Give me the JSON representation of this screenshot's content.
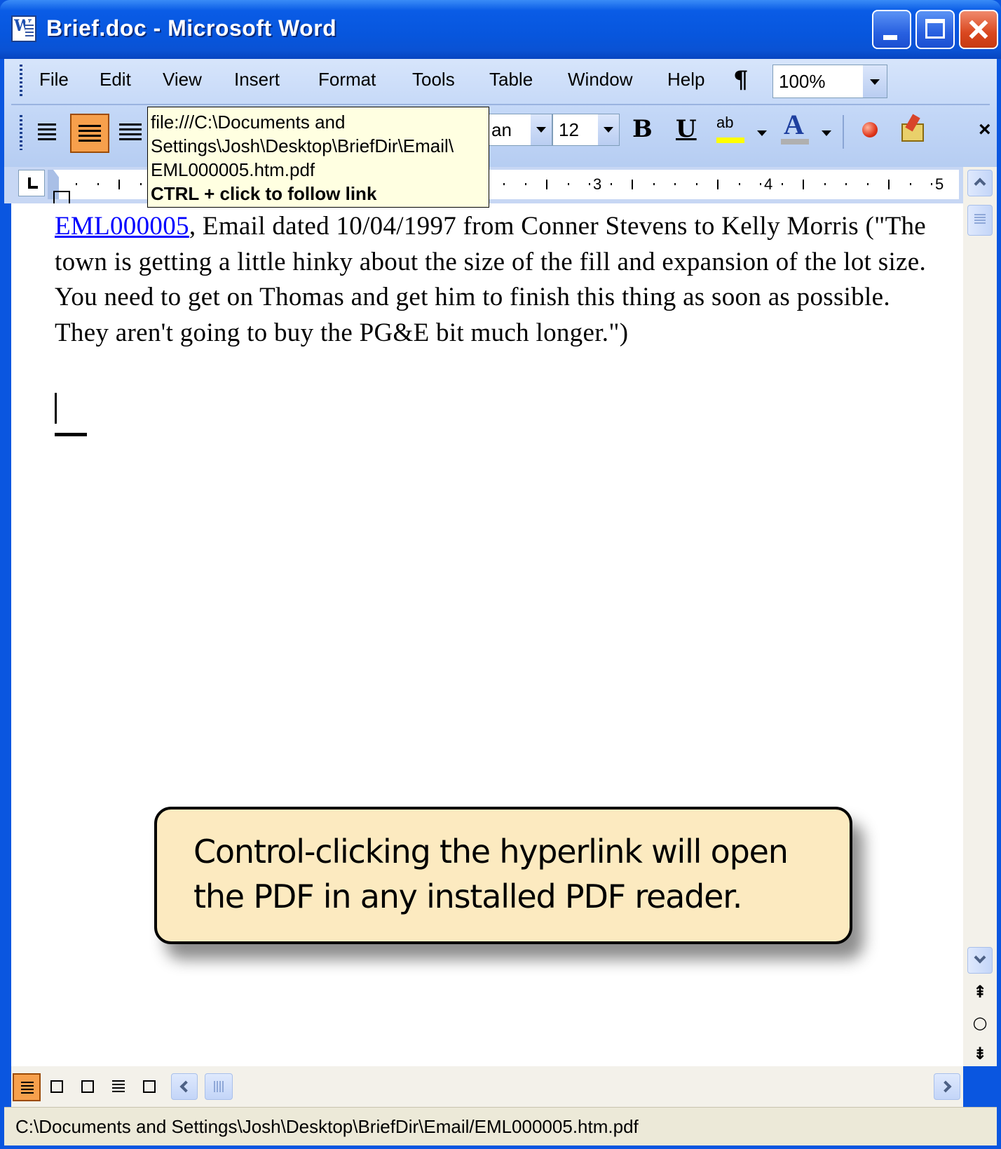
{
  "window": {
    "title": "Brief.doc - Microsoft Word"
  },
  "menu": {
    "items": [
      "File",
      "Edit",
      "View",
      "Insert",
      "Format",
      "Tools",
      "Table",
      "Window",
      "Help"
    ]
  },
  "toolbar": {
    "zoom": "100%",
    "font_name_partial": "an",
    "font_size": "12",
    "bold_label": "B",
    "underline_label": "U",
    "highlight_label": "ab",
    "font_color_label": "A",
    "close_label": "×",
    "pilcrow_label": "¶"
  },
  "ruler": {
    "numbers": [
      "3",
      "4",
      "5"
    ]
  },
  "tooltip": {
    "lines": [
      "file:///C:\\Documents and",
      "Settings\\Josh\\Desktop\\BriefDir\\Email\\",
      "EML000005.htm.pdf"
    ],
    "hint": "CTRL + click to follow link"
  },
  "document": {
    "link_text": "EML000005",
    "body_text": ", Email dated 10/04/1997 from Conner Stevens to Kelly Morris (\"The town is getting a little hinky about the size of the fill and expansion of the lot size. You need to get on Thomas and get him to finish this thing as soon as possible. They aren't going to buy the PG&E bit much longer.\")"
  },
  "callout": {
    "text": "Control-clicking the hyperlink will open the PDF in any installed PDF reader."
  },
  "status": {
    "text": "C:\\Documents and Settings\\Josh\\Desktop\\BriefDir\\Email/EML000005.htm.pdf"
  }
}
